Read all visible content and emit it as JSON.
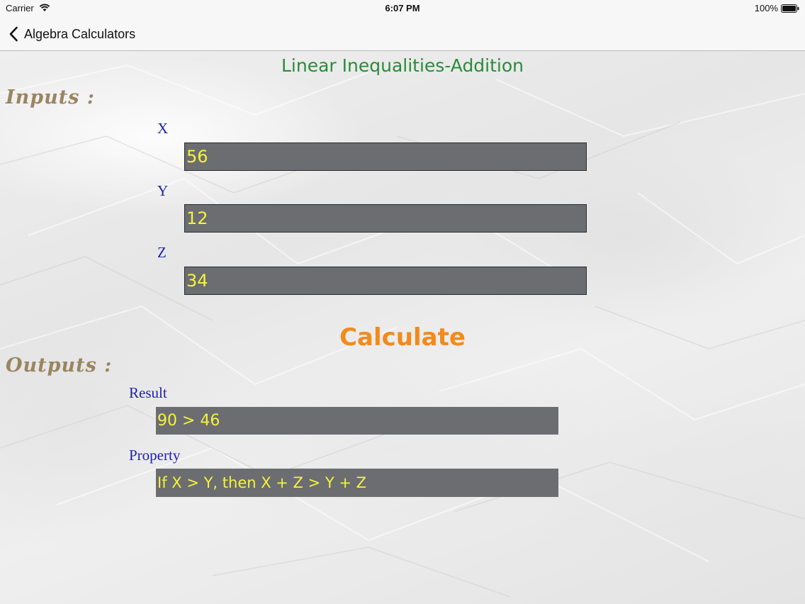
{
  "status_bar": {
    "carrier": "Carrier",
    "time": "6:07 PM",
    "battery": "100%",
    "wifi_icon": "wifi-icon",
    "battery_icon": "battery-icon"
  },
  "nav": {
    "back_label": "Algebra Calculators",
    "back_icon": "chevron-left-icon"
  },
  "page": {
    "title": "Linear Inequalities-Addition",
    "inputs_heading": "Inputs :",
    "outputs_heading": "Outputs :",
    "calculate_label": "Calculate"
  },
  "inputs": {
    "x": {
      "label": "X",
      "value": "56"
    },
    "y": {
      "label": "Y",
      "value": "12"
    },
    "z": {
      "label": "Z",
      "value": "34"
    }
  },
  "outputs": {
    "result": {
      "label": "Result",
      "value": "90 > 46"
    },
    "property": {
      "label": "Property",
      "value": "If X > Y, then X + Z > Y + Z"
    }
  },
  "colors": {
    "title": "#2a8c3a",
    "heading": "#9a8560",
    "label": "#1f1fb0",
    "field_bg": "#6c6d71",
    "field_text": "#f4f33a",
    "calculate": "#f28a1c"
  }
}
